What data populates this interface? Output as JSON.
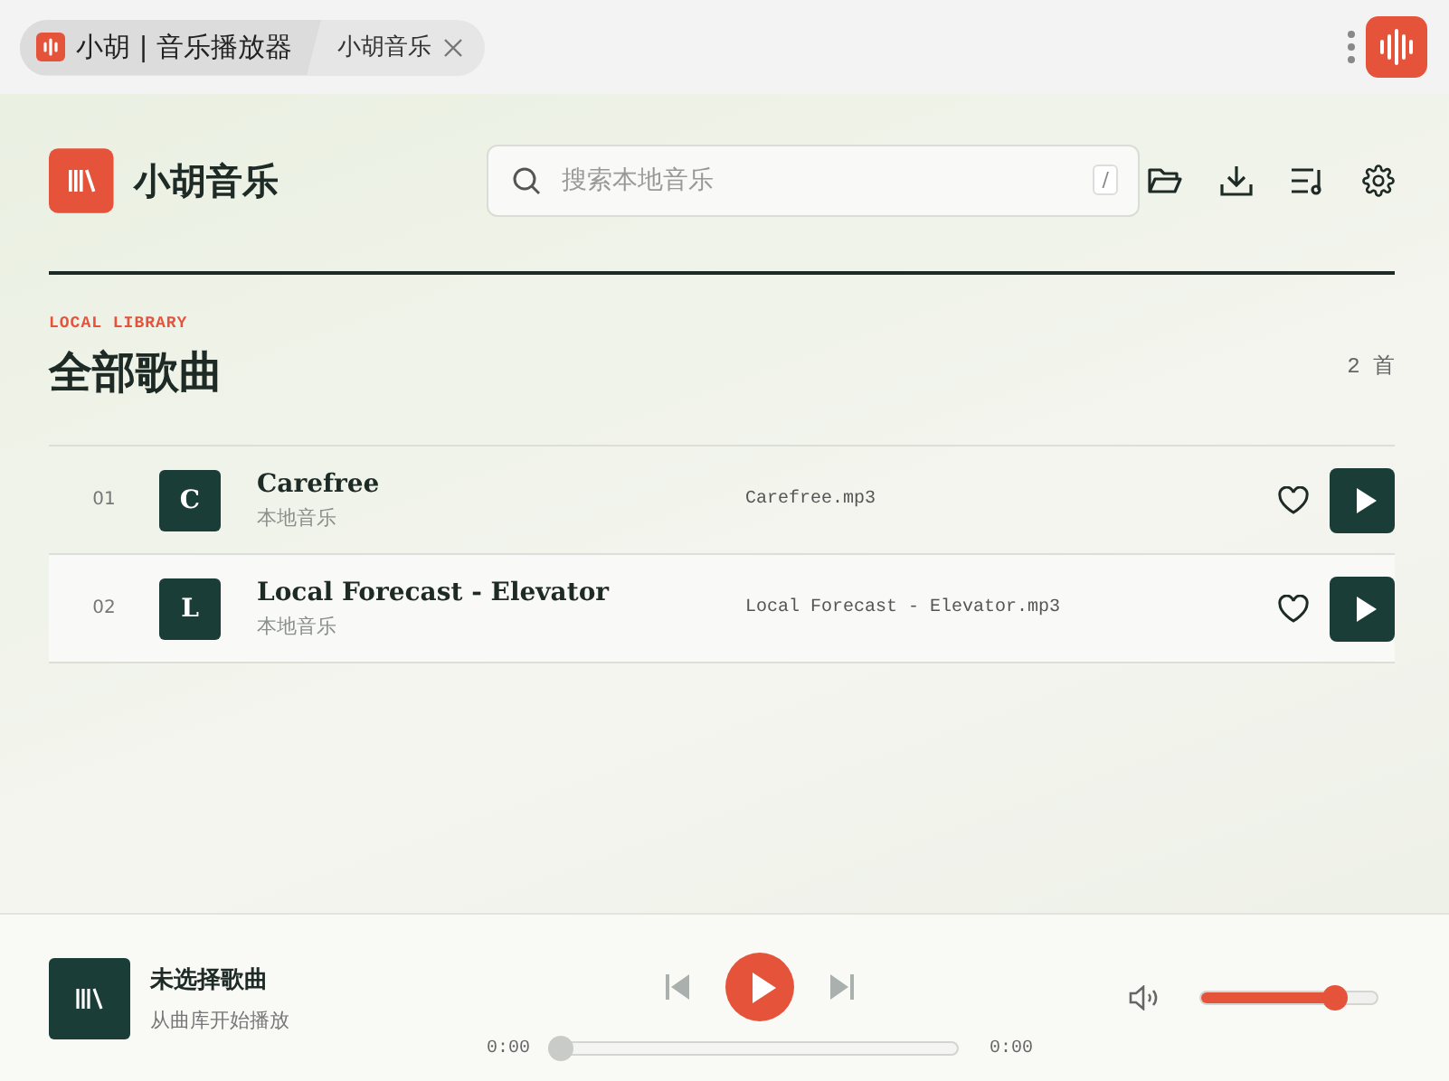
{
  "browser_tabs": [
    {
      "label": "小胡 | 音乐播放器",
      "selected": true,
      "closable": false
    },
    {
      "label": "小胡音乐",
      "selected": false,
      "closable": true
    }
  ],
  "header": {
    "title": "小胡音乐",
    "search": {
      "placeholder": "搜索本地音乐",
      "shortcut": "/"
    }
  },
  "library": {
    "eyebrow": "LOCAL LIBRARY",
    "heading": "全部歌曲",
    "count": "2 首",
    "songs": [
      {
        "index": "01",
        "initial": "C",
        "title": "Carefree",
        "source": "本地音乐",
        "file": "Carefree.mp3",
        "selected": false
      },
      {
        "index": "02",
        "initial": "L",
        "title": "Local Forecast - Elevator",
        "source": "本地音乐",
        "file": "Local Forecast - Elevator.mp3",
        "selected": true
      }
    ]
  },
  "player": {
    "title": "未选择歌曲",
    "subtitle": "从曲库开始播放",
    "elapsed": "0:00",
    "duration": "0:00",
    "progress": {
      "level": 0
    },
    "volume": {
      "level": 0.76
    }
  }
}
